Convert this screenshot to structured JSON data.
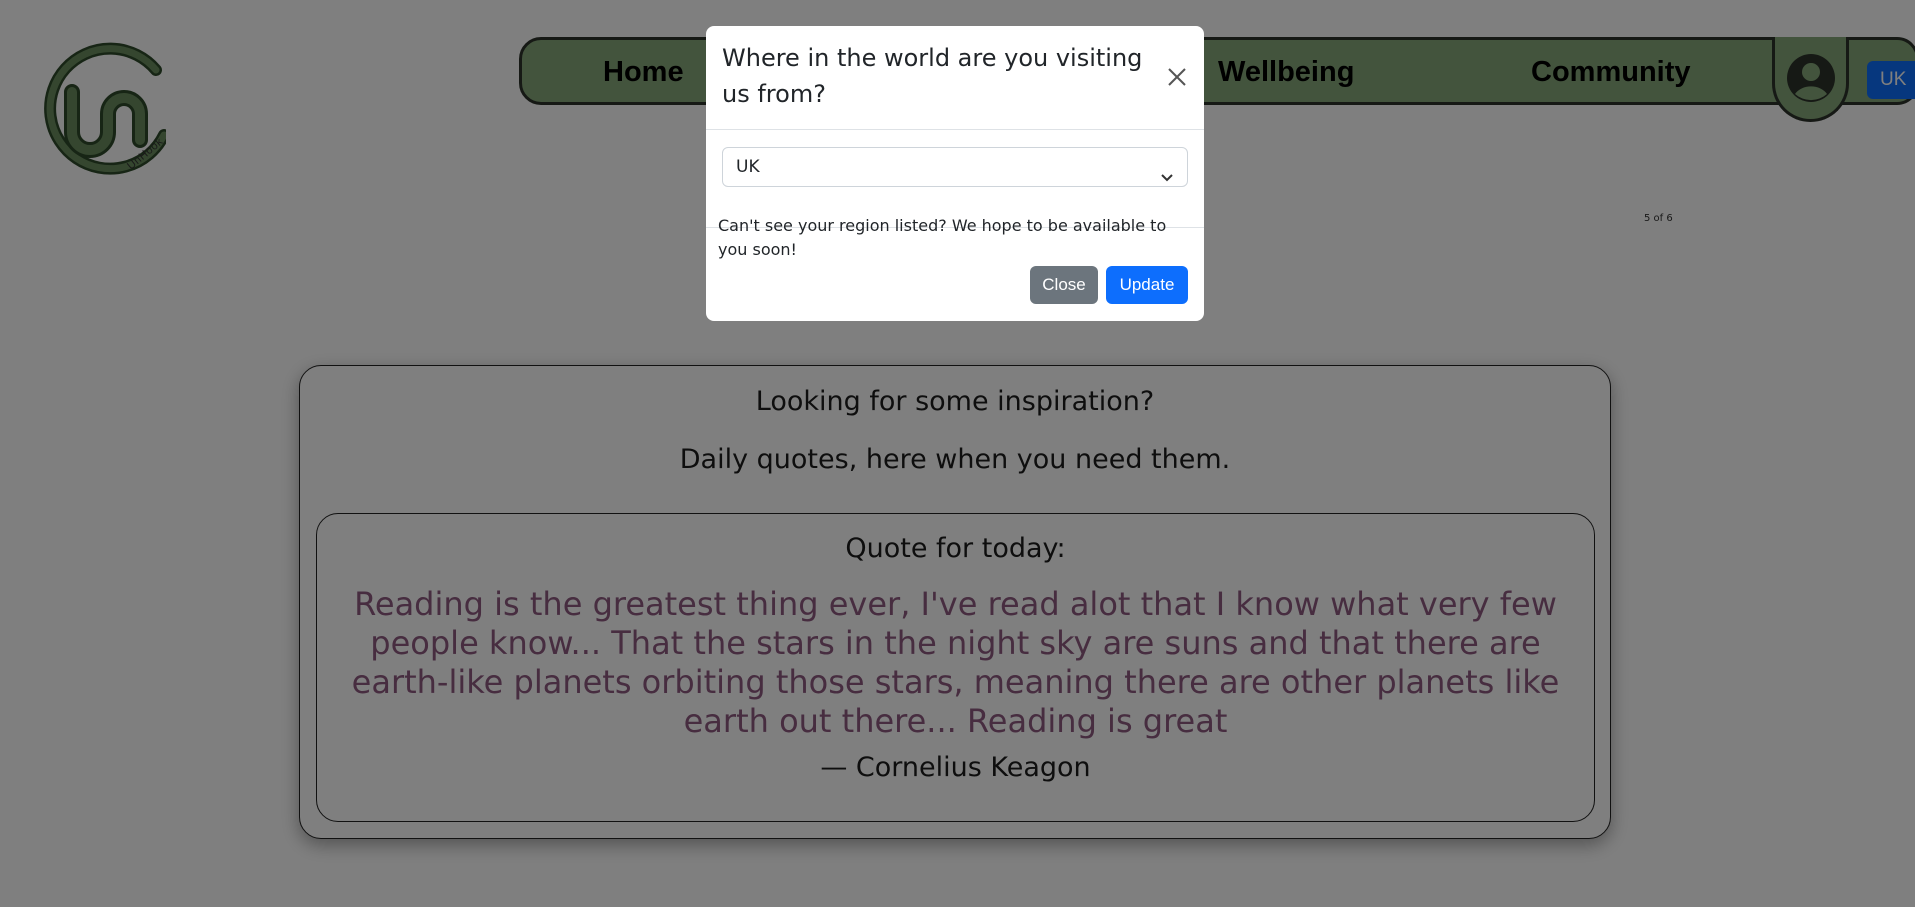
{
  "navbar": {
    "home_label": "Home",
    "wellbeing_label": "Wellbeing",
    "community_label": "Community",
    "region_button_label": "UK",
    "profile_icon": "user-circle-icon"
  },
  "logo": {
    "text": "UnHook"
  },
  "counter": {
    "text": "5 of 6"
  },
  "main": {
    "intro_title": "Looking for some inspiration?",
    "intro_subtitle": "Daily quotes, here when you need them.",
    "quote_heading": "Quote for today:",
    "quote_text": "Reading is the greatest thing ever, I've read alot that I know what very few people know... That the stars in the night sky are suns and that there are earth-like planets orbiting those stars, meaning there are other planets like earth out there... Reading is great",
    "quote_author": "— Cornelius Keagon"
  },
  "modal": {
    "title": "Where in the world are you visiting us from?",
    "close_icon": "close-icon",
    "select_value": "UK",
    "note": "Can't see your region listed? We hope to be available to you soon!",
    "close_button_label": "Close",
    "update_button_label": "Update"
  },
  "colors": {
    "nav_green": "#87a97a",
    "quote_purple": "#8e5a80",
    "primary_blue": "#0d6efd",
    "secondary_grey": "#6c757d"
  }
}
